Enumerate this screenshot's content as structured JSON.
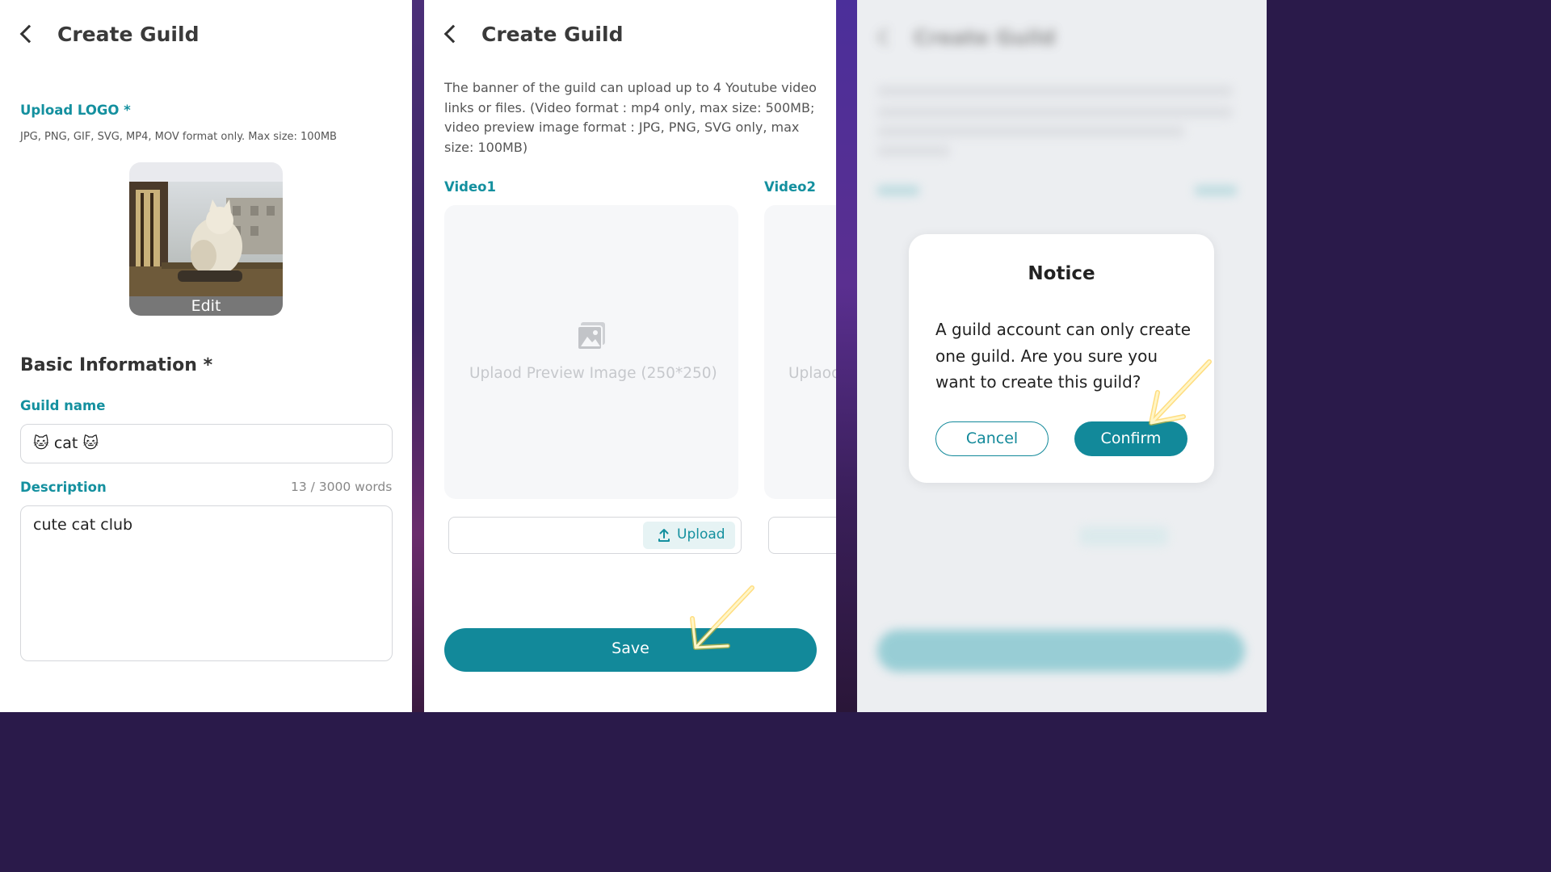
{
  "screen1": {
    "title": "Create Guild",
    "upload_logo_label": "Upload LOGO *",
    "upload_logo_hint": "JPG, PNG, GIF, SVG, MP4, MOV format only. Max size: 100MB",
    "logo_edit_label": "Edit",
    "basic_info_heading": "Basic Information *",
    "guild_name_label": "Guild name",
    "guild_name_value": "🐱 cat 🐱",
    "description_label": "Description",
    "description_count": "13 / 3000 words",
    "description_value": "cute cat club"
  },
  "screen2": {
    "title": "Create Guild",
    "banner_info": "The banner of the guild can upload up to 4 Youtube video links or files. (Video format : mp4 only, max size: 500MB; video preview image format : JPG, PNG, SVG only, max size: 100MB)",
    "video1_label": "Video1",
    "video2_label": "Video2",
    "video1_placeholder": "Uplaod Preview Image (250*250)",
    "video2_placeholder": "Uplaod",
    "upload_label": "Upload",
    "save_label": "Save"
  },
  "screen3": {
    "bg_title": "Create Guild",
    "notice_title": "Notice",
    "notice_body": "A guild account can only create one guild. Are you sure you want to create this guild?",
    "cancel_label": "Cancel",
    "confirm_label": "Confirm"
  },
  "colors": {
    "accent": "#12899a",
    "label_teal": "#14909f",
    "highlight_arrow": "#ffc21a"
  },
  "icons": {
    "back": "chevron-left-icon",
    "upload": "upload-icon",
    "image_placeholder": "image-icon"
  }
}
